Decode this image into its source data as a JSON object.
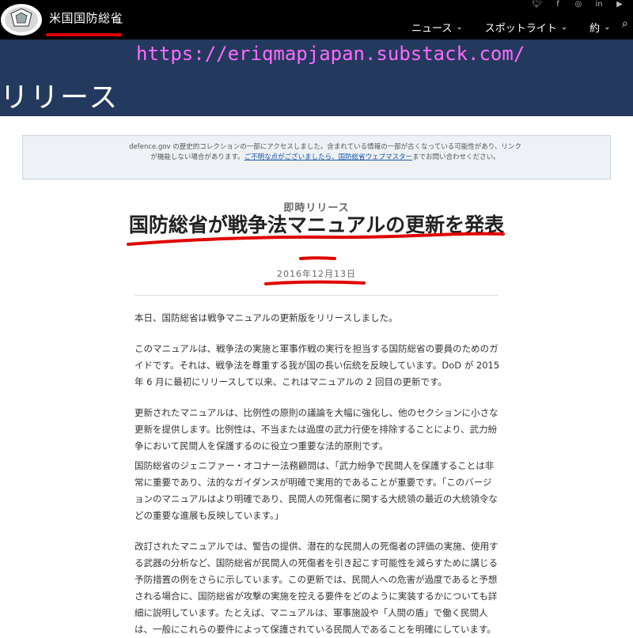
{
  "header": {
    "site_name": "米国国防総省",
    "nav": [
      {
        "label": "ニュース"
      },
      {
        "label": "スポットライト"
      },
      {
        "label": "約"
      }
    ],
    "social_icons": [
      "twitter-icon",
      "facebook-icon",
      "instagram-icon",
      "linkedin-icon",
      "youtube-icon"
    ]
  },
  "hero": {
    "watermark": "https://eriqmapjapan.substack.com/",
    "title": "リリース"
  },
  "notice": {
    "text_before": "defence.gov の歴史的コレクションの一部にアクセスしました。含まれている情報の一部が古くなっている可能性があり、リンクが機能しない場合があります。",
    "link": "ご不明な点がございましたら、国防総省ウェブマスター",
    "text_after": "までお問い合わせください。"
  },
  "article": {
    "kicker": "即時リリース",
    "headline": "国防総省が戦争法マニュアルの更新を発表",
    "date": "2016年12月13日",
    "paragraphs": [
      "本日、国防総省は戦争マニュアルの更新版をリリースしました。",
      "このマニュアルは、戦争法の実施と軍事作戦の実行を担当する国防総省の要員のためのガイドです。それは、戦争法を尊重する我が国の長い伝統を反映しています。DoD が 2015 年 6 月に最初にリリースして以来、これはマニュアルの 2 回目の更新です。",
      "更新されたマニュアルは、比例性の原則の議論を大幅に強化し、他のセクションに小さな更新を提供します。比例性は、不当または過度の武力行使を排除することにより、武力紛争において民間人を保護するのに役立つ重要な法的原則です。",
      "国防総省のジェニファー・オコナー法務顧問は、「武力紛争で民間人を保護することは非常に重要であり、法的なガイダンスが明確で実用的であることが重要です。「このバージョンのマニュアルはより明確であり、民間人の死傷者に関する大統領の最近の大統領令などの重要な進展も反映しています。」",
      "改訂されたマニュアルでは、警告の提供、潜在的な民間人の死傷者の評価の実施、使用する武器の分析など、国防総省が民間人の死傷者を引き起こす可能性を減らすために講じる予防措置の例をさらに示しています。この更新では、民間人への危害が過度であると予想される場合に、国防総省が攻撃の実施を控える要件をどのように実装するかについても詳細に説明しています。たとえば、マニュアルは、軍事施設や「人間の盾」で働く民間人は、一般にこれらの要件によって保護されている民間人であることを明確にしています。"
    ]
  },
  "colors": {
    "topbar": "#000000",
    "hero": "#23395d",
    "watermark": "#ff6bff",
    "annotation_red": "#e00000",
    "notice_bg": "#eef1f5",
    "link": "#1a56a8"
  }
}
